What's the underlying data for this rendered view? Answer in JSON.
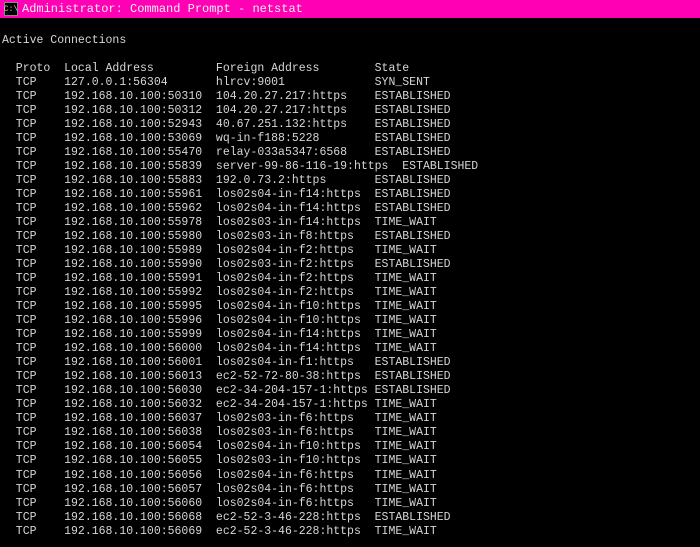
{
  "window": {
    "title": "Administrator: Command Prompt - netstat"
  },
  "terminal": {
    "header": "Active Connections",
    "columns": {
      "proto": "Proto",
      "local": "Local Address",
      "foreign": "Foreign Address",
      "state": "State"
    },
    "rows": [
      {
        "proto": "TCP",
        "local": "127.0.0.1:56304",
        "foreign": "hlrcv:9001",
        "state": "SYN_SENT"
      },
      {
        "proto": "TCP",
        "local": "192.168.10.100:50310",
        "foreign": "104.20.27.217:https",
        "state": "ESTABLISHED"
      },
      {
        "proto": "TCP",
        "local": "192.168.10.100:50312",
        "foreign": "104.20.27.217:https",
        "state": "ESTABLISHED"
      },
      {
        "proto": "TCP",
        "local": "192.168.10.100:52943",
        "foreign": "40.67.251.132:https",
        "state": "ESTABLISHED"
      },
      {
        "proto": "TCP",
        "local": "192.168.10.100:53069",
        "foreign": "wq-in-f188:5228",
        "state": "ESTABLISHED"
      },
      {
        "proto": "TCP",
        "local": "192.168.10.100:55470",
        "foreign": "relay-033a5347:6568",
        "state": "ESTABLISHED"
      },
      {
        "proto": "TCP",
        "local": "192.168.10.100:55839",
        "foreign": "server-99-86-116-19:https",
        "state": "ESTABLISHED"
      },
      {
        "proto": "TCP",
        "local": "192.168.10.100:55883",
        "foreign": "192.0.73.2:https",
        "state": "ESTABLISHED"
      },
      {
        "proto": "TCP",
        "local": "192.168.10.100:55961",
        "foreign": "los02s04-in-f14:https",
        "state": "ESTABLISHED"
      },
      {
        "proto": "TCP",
        "local": "192.168.10.100:55962",
        "foreign": "los02s04-in-f14:https",
        "state": "ESTABLISHED"
      },
      {
        "proto": "TCP",
        "local": "192.168.10.100:55978",
        "foreign": "los02s03-in-f14:https",
        "state": "TIME_WAIT"
      },
      {
        "proto": "TCP",
        "local": "192.168.10.100:55980",
        "foreign": "los02s03-in-f8:https",
        "state": "ESTABLISHED"
      },
      {
        "proto": "TCP",
        "local": "192.168.10.100:55989",
        "foreign": "los02s04-in-f2:https",
        "state": "TIME_WAIT"
      },
      {
        "proto": "TCP",
        "local": "192.168.10.100:55990",
        "foreign": "los02s03-in-f2:https",
        "state": "ESTABLISHED"
      },
      {
        "proto": "TCP",
        "local": "192.168.10.100:55991",
        "foreign": "los02s04-in-f2:https",
        "state": "TIME_WAIT"
      },
      {
        "proto": "TCP",
        "local": "192.168.10.100:55992",
        "foreign": "los02s04-in-f2:https",
        "state": "TIME_WAIT"
      },
      {
        "proto": "TCP",
        "local": "192.168.10.100:55995",
        "foreign": "los02s04-in-f10:https",
        "state": "TIME_WAIT"
      },
      {
        "proto": "TCP",
        "local": "192.168.10.100:55996",
        "foreign": "los02s04-in-f10:https",
        "state": "TIME_WAIT"
      },
      {
        "proto": "TCP",
        "local": "192.168.10.100:55999",
        "foreign": "los02s04-in-f14:https",
        "state": "TIME_WAIT"
      },
      {
        "proto": "TCP",
        "local": "192.168.10.100:56000",
        "foreign": "los02s04-in-f14:https",
        "state": "TIME_WAIT"
      },
      {
        "proto": "TCP",
        "local": "192.168.10.100:56001",
        "foreign": "los02s04-in-f1:https",
        "state": "ESTABLISHED"
      },
      {
        "proto": "TCP",
        "local": "192.168.10.100:56013",
        "foreign": "ec2-52-72-80-38:https",
        "state": "ESTABLISHED"
      },
      {
        "proto": "TCP",
        "local": "192.168.10.100:56030",
        "foreign": "ec2-34-204-157-1:https",
        "state": "ESTABLISHED"
      },
      {
        "proto": "TCP",
        "local": "192.168.10.100:56032",
        "foreign": "ec2-34-204-157-1:https",
        "state": "TIME_WAIT"
      },
      {
        "proto": "TCP",
        "local": "192.168.10.100:56037",
        "foreign": "los02s03-in-f6:https",
        "state": "TIME_WAIT"
      },
      {
        "proto": "TCP",
        "local": "192.168.10.100:56038",
        "foreign": "los02s03-in-f6:https",
        "state": "TIME_WAIT"
      },
      {
        "proto": "TCP",
        "local": "192.168.10.100:56054",
        "foreign": "los02s04-in-f10:https",
        "state": "TIME_WAIT"
      },
      {
        "proto": "TCP",
        "local": "192.168.10.100:56055",
        "foreign": "los02s03-in-f10:https",
        "state": "TIME_WAIT"
      },
      {
        "proto": "TCP",
        "local": "192.168.10.100:56056",
        "foreign": "los02s04-in-f6:https",
        "state": "TIME_WAIT"
      },
      {
        "proto": "TCP",
        "local": "192.168.10.100:56057",
        "foreign": "los02s04-in-f6:https",
        "state": "TIME_WAIT"
      },
      {
        "proto": "TCP",
        "local": "192.168.10.100:56060",
        "foreign": "los02s04-in-f6:https",
        "state": "TIME_WAIT"
      },
      {
        "proto": "TCP",
        "local": "192.168.10.100:56068",
        "foreign": "ec2-52-3-46-228:https",
        "state": "ESTABLISHED"
      },
      {
        "proto": "TCP",
        "local": "192.168.10.100:56069",
        "foreign": "ec2-52-3-46-228:https",
        "state": "TIME_WAIT"
      }
    ]
  }
}
